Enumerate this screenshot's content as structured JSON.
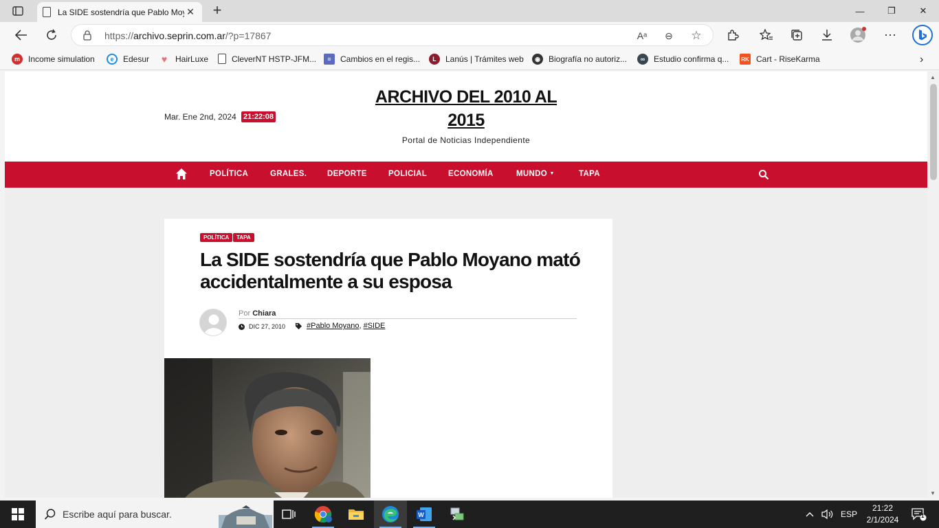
{
  "browser": {
    "tab_title": "La SIDE sostendría que Pablo Moy",
    "url_prefix": "https://",
    "url_host": "archivo.seprin.com.ar",
    "url_path": "/?p=17867"
  },
  "bookmarks": [
    {
      "label": "Income simulation",
      "color": "#d32f2f",
      "glyph": "m"
    },
    {
      "label": "Edesur",
      "color": "#1e88e5",
      "glyph": "e"
    },
    {
      "label": "HairLuxe",
      "color": "#e57373",
      "glyph": "♥"
    },
    {
      "label": "CleverNT HSTP-JFM...",
      "color": "#ffffff",
      "glyph": ""
    },
    {
      "label": "Cambios en el regis...",
      "color": "#5c6bc0",
      "glyph": "≡"
    },
    {
      "label": "Lanús | Trámites web",
      "color": "#8e1b2c",
      "glyph": "L"
    },
    {
      "label": "Biografía no autoriz...",
      "color": "#333333",
      "glyph": "◉"
    },
    {
      "label": "Estudio confirma q...",
      "color": "#37474f",
      "glyph": "∞"
    },
    {
      "label": "Cart - RiseKarma",
      "color": "#f4511e",
      "glyph": "RK"
    }
  ],
  "site": {
    "date": "Mar. Ene 2nd, 2024",
    "time": "21:22:08",
    "title": "ARCHIVO DEL 2010 AL 2015",
    "tagline": "Portal de Noticias Independiente",
    "accent": "#c8102e"
  },
  "nav": {
    "items": [
      "POLÍTICA",
      "GRALES.",
      "DEPORTE",
      "POLICIAL",
      "ECONOMÍA",
      "MUNDO",
      "TAPA"
    ]
  },
  "article": {
    "categories": [
      "POLÍTICA",
      "TAPA"
    ],
    "headline": "La SIDE sostendría que Pablo Moyano mató accidentalmente a su esposa",
    "author_prefix": "Por",
    "author": "Chiara",
    "date": "DIC 27, 2010",
    "tags": [
      "#Pablo Moyano",
      "#SIDE"
    ]
  },
  "taskbar": {
    "search_placeholder": "Escribe aquí para buscar.",
    "language": "ESP",
    "time": "21:22",
    "date": "2/1/2024",
    "notification_count": "1"
  }
}
